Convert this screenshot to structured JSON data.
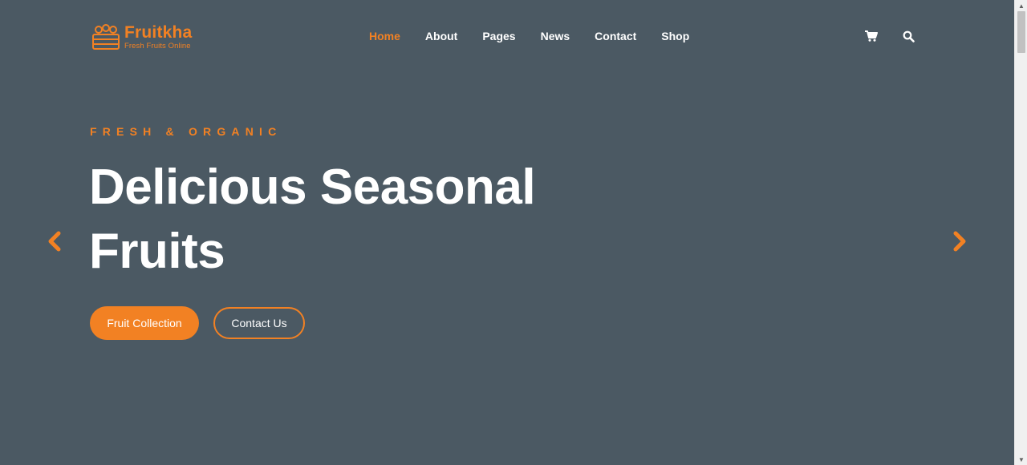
{
  "brand": {
    "name": "Fruitkha",
    "tagline": "Fresh Fruits Online"
  },
  "nav": {
    "items": [
      {
        "label": "Home",
        "active": true
      },
      {
        "label": "About",
        "active": false
      },
      {
        "label": "Pages",
        "active": false
      },
      {
        "label": "News",
        "active": false
      },
      {
        "label": "Contact",
        "active": false
      },
      {
        "label": "Shop",
        "active": false
      }
    ]
  },
  "header_icons": [
    "shopping-cart-icon",
    "search-icon"
  ],
  "hero": {
    "eyebrow": "FRESH & ORGANIC",
    "title_line1": "Delicious Seasonal",
    "title_line2": "Fruits",
    "primary_button": "Fruit Collection",
    "secondary_button": "Contact Us"
  },
  "slider": {
    "prev_icon": "chevron-left-icon",
    "next_icon": "chevron-right-icon"
  },
  "colors": {
    "background": "#4b5963",
    "accent": "#f28123",
    "text": "#ffffff"
  }
}
